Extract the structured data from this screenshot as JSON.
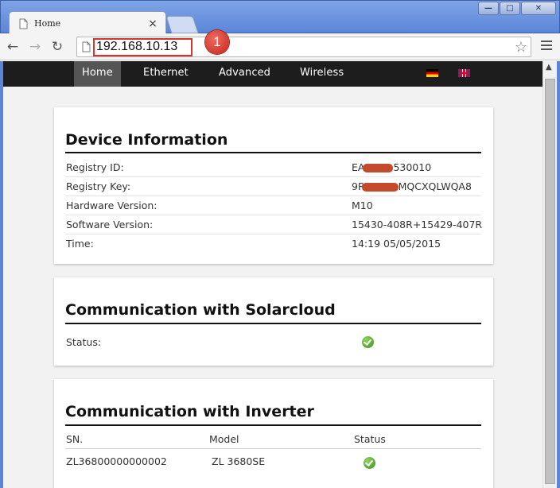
{
  "browser": {
    "tab_title": "Home",
    "tab_close": "×",
    "url": "192.168.10.13",
    "callout_number": "1",
    "window_controls": {
      "minimize": "—",
      "maximize": "□",
      "close": "✕"
    }
  },
  "site_nav": {
    "items": [
      "Home",
      "Ethernet",
      "Advanced",
      "Wireless"
    ],
    "active": "Home",
    "languages": [
      "de-flag-icon",
      "uk-flag-icon"
    ]
  },
  "device_info": {
    "title": "Device Information",
    "rows": [
      {
        "label": "Registry ID:",
        "value": "EA",
        "value_suffix": "530010"
      },
      {
        "label": "Registry Key:",
        "value": "9R",
        "value_suffix": "MQCXQLWQA8"
      },
      {
        "label": "Hardware Version:",
        "value": "M10"
      },
      {
        "label": "Software Version:",
        "value": "15430-408R+15429-407R"
      },
      {
        "label": "Time:",
        "value": "14:19 05/05/2015"
      }
    ]
  },
  "solarcloud": {
    "title": "Communication with Solarcloud",
    "status_label": "Status:",
    "status_icon": "check-ok-icon"
  },
  "inverter": {
    "title": "Communication with Inverter",
    "columns": [
      "SN.",
      "Model",
      "Status"
    ],
    "rows": [
      {
        "sn": "ZL36800000000002",
        "model": "ZL 3680SE",
        "status_icon": "check-ok-icon"
      }
    ]
  },
  "colors": {
    "nav_bg": "#1d1d1d",
    "nav_active": "#555555",
    "callout_red": "#d9342b",
    "status_green": "#3e8e1e"
  }
}
